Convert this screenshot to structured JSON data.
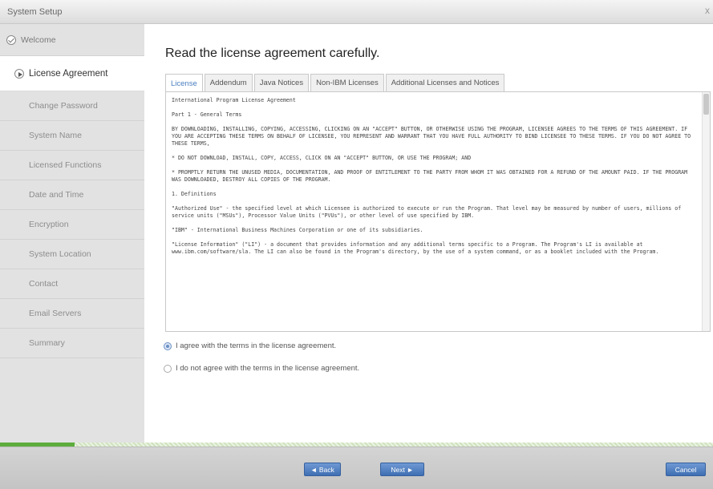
{
  "window": {
    "title": "System Setup",
    "close_glyph": "x"
  },
  "sidebar": {
    "items": [
      {
        "label": "Welcome",
        "state": "completed",
        "icon": "check-circle-icon"
      },
      {
        "label": "License Agreement",
        "state": "current",
        "icon": "arrow-circle-icon"
      },
      {
        "label": "Change Password",
        "state": "pending"
      },
      {
        "label": "System Name",
        "state": "pending"
      },
      {
        "label": "Licensed Functions",
        "state": "pending"
      },
      {
        "label": "Date and Time",
        "state": "pending"
      },
      {
        "label": "Encryption",
        "state": "pending"
      },
      {
        "label": "System Location",
        "state": "pending"
      },
      {
        "label": "Contact",
        "state": "pending"
      },
      {
        "label": "Email Servers",
        "state": "pending"
      },
      {
        "label": "Summary",
        "state": "pending"
      }
    ]
  },
  "main": {
    "heading": "Read the license agreement carefully.",
    "tabs": [
      {
        "label": "License",
        "active": true
      },
      {
        "label": "Addendum",
        "active": false
      },
      {
        "label": "Java Notices",
        "active": false
      },
      {
        "label": "Non-IBM Licenses",
        "active": false
      },
      {
        "label": "Additional Licenses and Notices",
        "active": false
      }
    ],
    "license_paragraphs": [
      "International Program License Agreement",
      "Part 1 - General Terms",
      "BY DOWNLOADING, INSTALLING, COPYING, ACCESSING, CLICKING ON AN \"ACCEPT\" BUTTON, OR OTHERWISE USING THE PROGRAM, LICENSEE AGREES TO THE TERMS OF THIS AGREEMENT. IF YOU ARE ACCEPTING THESE TERMS ON BEHALF OF LICENSEE, YOU REPRESENT AND WARRANT THAT YOU HAVE FULL AUTHORITY TO BIND LICENSEE TO THESE TERMS. IF YOU DO NOT AGREE TO THESE TERMS,",
      "* DO NOT DOWNLOAD, INSTALL, COPY, ACCESS, CLICK ON AN \"ACCEPT\" BUTTON, OR USE THE PROGRAM; AND",
      "* PROMPTLY RETURN THE UNUSED MEDIA, DOCUMENTATION, AND PROOF OF ENTITLEMENT TO THE PARTY FROM WHOM IT WAS OBTAINED FOR A REFUND OF THE AMOUNT PAID. IF THE PROGRAM WAS DOWNLOADED, DESTROY ALL COPIES OF THE PROGRAM.",
      "1. Definitions",
      "\"Authorized Use\" - the specified level at which Licensee is authorized to execute or run the Program. That level may be measured by number of users, millions of service units (\"MSUs\"), Processor Value Units (\"PVUs\"), or other level of use specified by IBM.",
      "\"IBM\" - International Business Machines Corporation or one of its subsidiaries.",
      "\"License Information\" (\"LI\") - a document that provides information and any additional terms specific to a Program. The Program's LI is available at www.ibm.com/software/sla. The LI can also be found in the Program's directory, by the use of a system command, or as a booklet included with the Program."
    ],
    "agree_option": {
      "label": "I agree with the terms in the license agreement.",
      "selected": true
    },
    "disagree_option": {
      "label": "I do not agree with the terms in the license agreement.",
      "selected": false
    }
  },
  "progress": {
    "fraction": 0.105,
    "color": "#5cad3c"
  },
  "footer": {
    "back_label": "◄ Back",
    "next_label": "Next ►",
    "cancel_label": "Cancel"
  },
  "colors": {
    "accent": "#4a7ec0",
    "button": "#4f7fc2",
    "sidebar": "#e2e2e2"
  }
}
